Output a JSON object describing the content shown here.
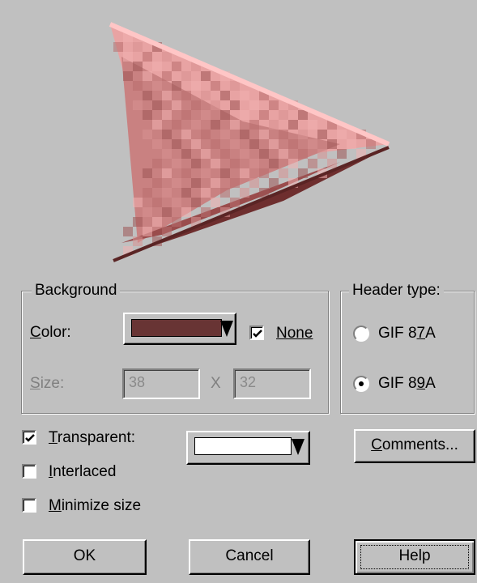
{
  "colors": {
    "background": "#c0c0c0",
    "bg_swatch": "#683434",
    "transparent_swatch": "#ffffff",
    "preview_light": "#ffb3b3",
    "preview_mid": "#e39a9a",
    "preview_dark": "#a05a5a",
    "preview_darker": "#6e2e2e"
  },
  "preview": {
    "icon": "red-arrow-pointer-icon"
  },
  "background_group": {
    "legend": "Background",
    "color_label": "Color:",
    "none_label": "None",
    "none_checked": true,
    "size_label": "Size:",
    "width": "38",
    "x_sep": "X",
    "height": "32"
  },
  "header_group": {
    "legend": "Header type:",
    "options": [
      "GIF 87A",
      "GIF 89A"
    ],
    "selected": "GIF 89A"
  },
  "options": {
    "transparent_label": "Transparent:",
    "transparent_checked": true,
    "interlaced_label": "Interlaced",
    "interlaced_checked": false,
    "minimize_label": "Minimize size",
    "minimize_checked": false,
    "comments_button": "Comments..."
  },
  "buttons": {
    "ok": "OK",
    "cancel": "Cancel",
    "help": "Help"
  }
}
